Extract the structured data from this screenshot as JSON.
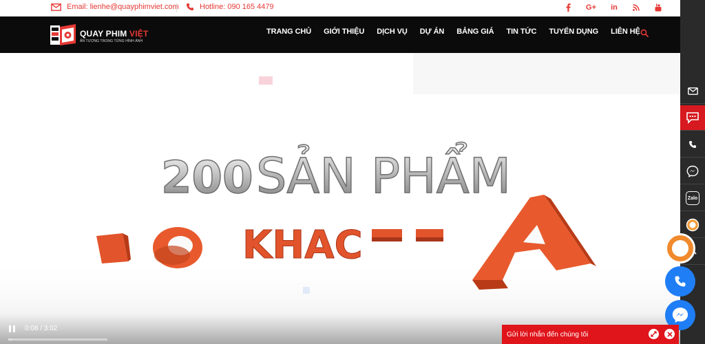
{
  "topbar": {
    "email_text": "Email: lienhe@quayphimviet.com",
    "hotline_text": "Hotline: 090 165 4479",
    "socials": [
      {
        "icon": "facebook-icon",
        "label": "f"
      },
      {
        "icon": "google-plus-icon",
        "label": "G+"
      },
      {
        "icon": "linkedin-icon",
        "label": "in"
      },
      {
        "icon": "rss-icon",
        "label": "rss"
      },
      {
        "icon": "youtube-icon",
        "label": "yt"
      }
    ]
  },
  "header": {
    "logo_brand_white": "QUAY PHIM ",
    "logo_brand_red": "VIỆT",
    "logo_tagline": "ẤN TƯỢNG TRONG TỪNG HÌNH ẢNH",
    "nav": [
      "TRANG CHỦ",
      "GIỚI THIỆU",
      "DỊCH VỤ",
      "DỰ ÁN",
      "BẢNG GIÁ",
      "TIN TỨC",
      "TUYỂN DỤNG",
      "LIÊN HỆ"
    ]
  },
  "video": {
    "headline_number": "200",
    "headline_text": "SẢN PHẨM",
    "subline_text": "KHAC",
    "timecode": "0:08 / 3:02",
    "progress_fraction": 0.044
  },
  "rail": {
    "items": [
      "email-icon",
      "chat-icon",
      "phone-icon",
      "messenger-icon",
      "zalo-icon",
      "badge-icon",
      "chevron-up-icon"
    ],
    "zalo_label": "Zalo"
  },
  "chat": {
    "label": "Gửi lời nhắn đến chúng tôi"
  },
  "colors": {
    "accent": "#e53935",
    "header_bg": "#0b0b0b",
    "rail_bg": "#2a2a2a",
    "chat_bg": "#e0141b",
    "messenger_blue": "#1f7ef5"
  }
}
